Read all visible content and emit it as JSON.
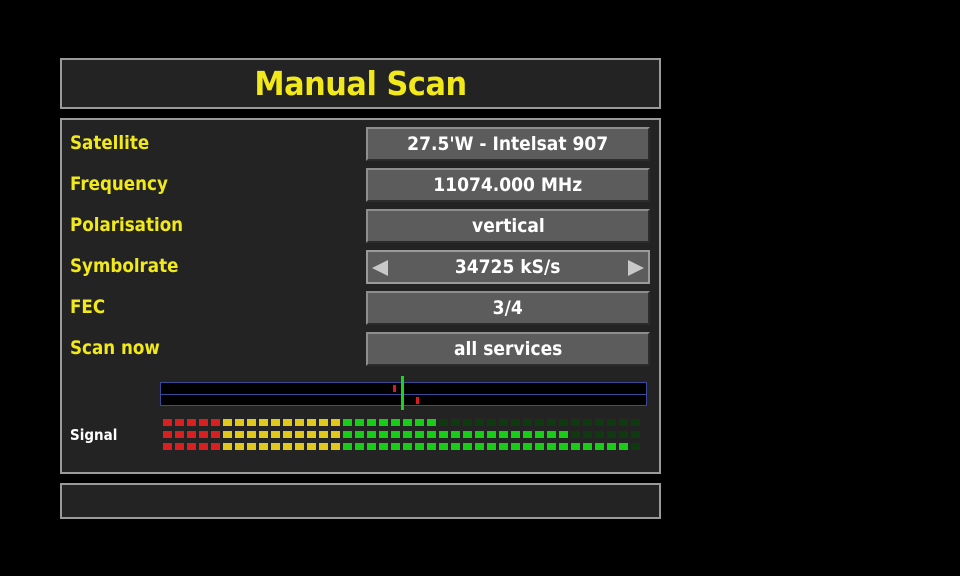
{
  "title": "Manual Scan",
  "rows": [
    {
      "label": "Satellite",
      "value": "27.5'W - Intelsat 907"
    },
    {
      "label": "Frequency",
      "value": "11074.000 MHz"
    },
    {
      "label": "Polarisation",
      "value": "vertical"
    },
    {
      "label": "Symbolrate",
      "value": "34725 kS/s"
    },
    {
      "label": "FEC",
      "value": "3/4"
    },
    {
      "label": "Scan now",
      "value": "all services"
    }
  ],
  "tuner": {
    "needle_position": 0.5
  },
  "signal": {
    "label": "Signal",
    "segments_total": 40,
    "levels": [
      23,
      34,
      39
    ],
    "colors": {
      "red": "#d82020",
      "yellow": "#e0c81c",
      "green": "#18cc18",
      "off": "#0f3a0f"
    }
  },
  "colors": {
    "title": "#f2e91a",
    "label": "#f2e91a",
    "panel": "#232323",
    "field": "#5c5c5c",
    "background": "#000000"
  }
}
